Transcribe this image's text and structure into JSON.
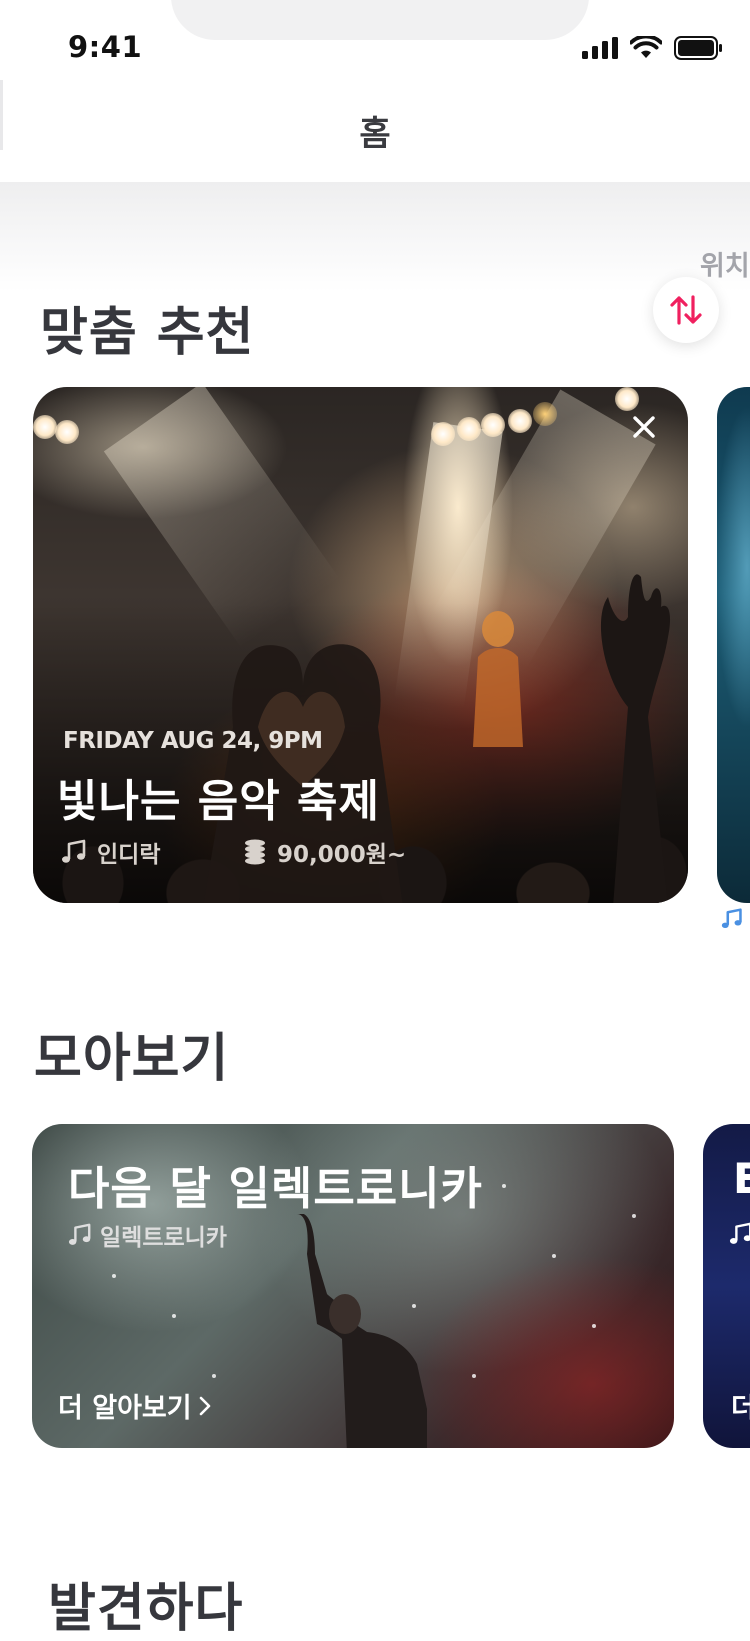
{
  "status_bar": {
    "time": "9:41"
  },
  "header": {
    "title": "홈"
  },
  "side_label": "위치",
  "sections": {
    "recommended": "맞춤 추천",
    "collections": "모아보기",
    "discover": "발견하다"
  },
  "hero_card": {
    "date": "FRIDAY AUG 24, 9PM",
    "title": "빛나는 음악 축제",
    "genre": "인디락",
    "price": "90,000원~"
  },
  "collection_card": {
    "title": "다음 달 일렉트로니카",
    "genre": "일렉트로니카",
    "cta": "더 알아보기"
  },
  "peek_collection_card": {
    "title_initial": "E",
    "cta_initial": "더"
  },
  "colors": {
    "accent": "#f0205f",
    "text_dark": "#36373d",
    "text_muted": "#a3a4aa",
    "peek_icon": "#4a90e2"
  },
  "icons": {
    "sort": "sort-arrows-icon",
    "close": "close-icon",
    "genre": "music-note-icon",
    "price": "coins-icon",
    "chevron": "chevron-right-icon"
  }
}
